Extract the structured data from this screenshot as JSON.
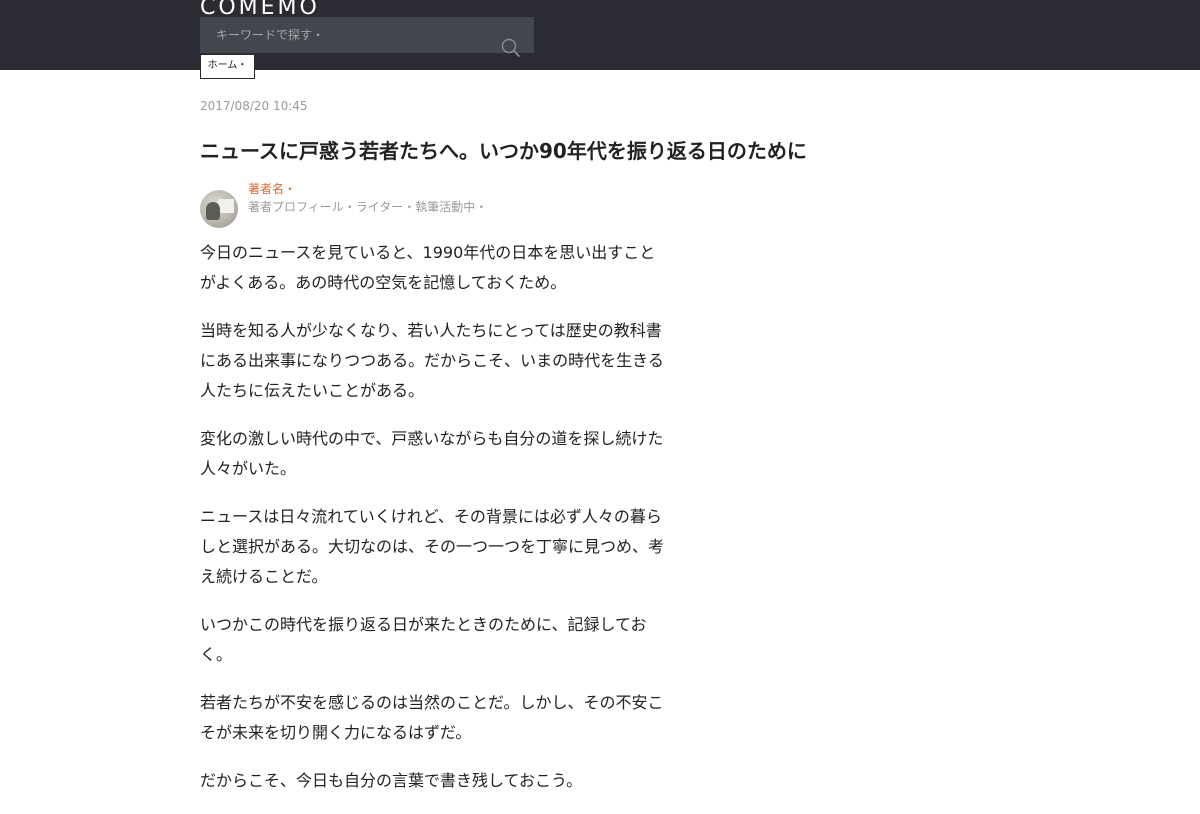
{
  "header": {
    "logo_text": "COMEMO",
    "search_placeholder": "キーワードで探す・",
    "category_label": "ホーム・"
  },
  "article": {
    "date": "2017/08/20 10:45",
    "title": "ニュースに戸惑う若者たちへ。いつか90年代を振り返る日のために",
    "author": {
      "name": "著者名・",
      "description": "著者プロフィール・ライター・執筆活動中・"
    },
    "paragraphs": [
      "今日のニュースを見ていると、1990年代の日本を思い出すことがよくある。あの時代の空気を記憶しておくため。",
      "当時を知る人が少なくなり、若い人たちにとっては歴史の教科書にある出来事になりつつある。だからこそ、いまの時代を生きる人たちに伝えたいことがある。",
      "変化の激しい時代の中で、戸惑いながらも自分の道を探し続けた人々がいた。",
      "ニュースは日々流れていくけれど、その背景には必ず人々の暮らしと選択がある。大切なのは、その一つ一つを丁寧に見つめ、考え続けることだ。",
      "いつかこの時代を振り返る日が来たときのために、記録しておく。",
      "若者たちが不安を感じるのは当然のことだ。しかし、その不安こそが未来を切り開く力になるはずだ。",
      "だからこそ、今日も自分の言葉で書き残しておこう。"
    ]
  },
  "colors": {
    "header_bg": "#2b2c33",
    "search_bg": "#44464d",
    "accent": "#e0682d",
    "muted": "#9a9a9a"
  },
  "icons": {
    "search": "search-icon"
  }
}
